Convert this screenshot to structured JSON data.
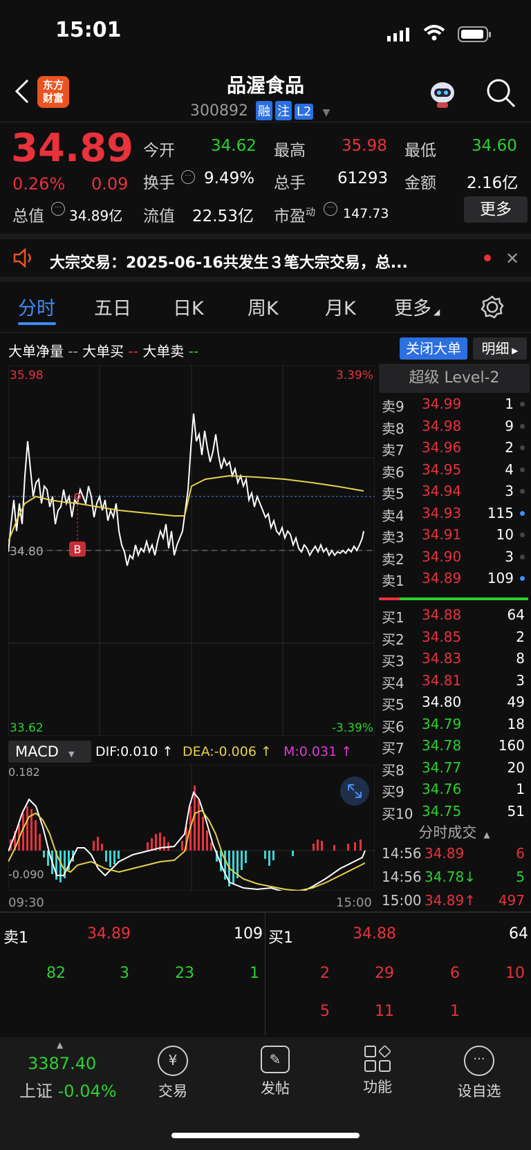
{
  "status_bar": {
    "time": "15:01"
  },
  "header": {
    "logo_text": "东方\n财富",
    "title": "品渥食品",
    "code": "300892",
    "tags": [
      "融",
      "注",
      "L2"
    ]
  },
  "quote": {
    "price": "34.89",
    "change_pct": "0.26%",
    "change": "0.09",
    "open_label": "今开",
    "open": "34.62",
    "high_label": "最高",
    "high": "35.98",
    "low_label": "最低",
    "low": "34.60",
    "turnover_label": "换手",
    "turnover": "9.49%",
    "volume_label": "总手",
    "volume": "61293",
    "amount_label": "金额",
    "amount": "2.16亿",
    "mcap_label": "总值",
    "mcap": "34.89亿",
    "float_label": "流值",
    "float": "22.53亿",
    "pe_label": "市盈",
    "pe_sup": "动",
    "pe": "147.73",
    "more_button": "更多"
  },
  "notice": {
    "text": "大宗交易：2025-06-16共发生３笔大宗交易，总..."
  },
  "tabs": [
    "分时",
    "五日",
    "日K",
    "周K",
    "月K",
    "更多"
  ],
  "indicator_bar": {
    "net": "大单净量",
    "buy": "大单买",
    "sell": "大单卖",
    "close_btn": "关闭大单",
    "detail_btn": "明细"
  },
  "chart_labels": {
    "top_left": "35.98",
    "top_right": "3.39%",
    "bottom_left": "33.62",
    "bottom_right": "-3.39%",
    "ref": "34.80",
    "marker": "B"
  },
  "macd": {
    "label": "MACD",
    "dif": "DIF:0.010 ↑",
    "dea": "DEA:-0.006 ↑",
    "m": "M:0.031 ↑",
    "top": "0.182",
    "bottom": "-0.090",
    "t_start": "09:30",
    "t_end": "15:00"
  },
  "orderbook": {
    "title": "超级 Level-2",
    "asks": [
      {
        "label": "卖9",
        "price": "34.99",
        "qty": "1"
      },
      {
        "label": "卖8",
        "price": "34.98",
        "qty": "9"
      },
      {
        "label": "卖7",
        "price": "34.96",
        "qty": "2"
      },
      {
        "label": "卖6",
        "price": "34.95",
        "qty": "4"
      },
      {
        "label": "卖5",
        "price": "34.94",
        "qty": "3"
      },
      {
        "label": "卖4",
        "price": "34.93",
        "qty": "115"
      },
      {
        "label": "卖3",
        "price": "34.91",
        "qty": "10"
      },
      {
        "label": "卖2",
        "price": "34.90",
        "qty": "3"
      },
      {
        "label": "卖1",
        "price": "34.89",
        "qty": "109"
      }
    ],
    "bids": [
      {
        "label": "买1",
        "price": "34.88",
        "qty": "64",
        "color": "#e8323c"
      },
      {
        "label": "买2",
        "price": "34.85",
        "qty": "2",
        "color": "#e8323c"
      },
      {
        "label": "买3",
        "price": "34.83",
        "qty": "8",
        "color": "#e8323c"
      },
      {
        "label": "买4",
        "price": "34.81",
        "qty": "3",
        "color": "#e8323c"
      },
      {
        "label": "买5",
        "price": "34.80",
        "qty": "49",
        "color": "#ffffff"
      },
      {
        "label": "买6",
        "price": "34.79",
        "qty": "18",
        "color": "#2bd12e"
      },
      {
        "label": "买7",
        "price": "34.78",
        "qty": "160",
        "color": "#2bd12e"
      },
      {
        "label": "买8",
        "price": "34.77",
        "qty": "20",
        "color": "#2bd12e"
      },
      {
        "label": "买9",
        "price": "34.76",
        "qty": "1",
        "color": "#2bd12e"
      },
      {
        "label": "买10",
        "price": "34.75",
        "qty": "51",
        "color": "#2bd12e"
      }
    ],
    "trades_title": "分时成交",
    "trades": [
      {
        "time": "14:56",
        "price": "34.89",
        "qty": "6",
        "color": "#e8323c"
      },
      {
        "time": "14:56",
        "price": "34.78↓",
        "qty": "5",
        "color": "#2bd12e"
      },
      {
        "time": "15:00",
        "price": "34.89↑",
        "qty": "497",
        "color": "#e8323c"
      }
    ]
  },
  "queue": {
    "sell_label": "卖1",
    "sell_price": "34.89",
    "sell_qty": "109",
    "buy_label": "买1",
    "buy_price": "34.88",
    "buy_qty": "64",
    "sell_orders": [
      "82",
      "3",
      "23",
      "1"
    ],
    "buy_orders": [
      "2",
      "29",
      "6",
      "10",
      "5",
      "11",
      "1"
    ]
  },
  "bottom": {
    "index_value": "3387.40",
    "index_name": "上证",
    "index_change": "-0.04%",
    "nav": [
      "交易",
      "发帖",
      "功能",
      "设自选"
    ]
  }
}
